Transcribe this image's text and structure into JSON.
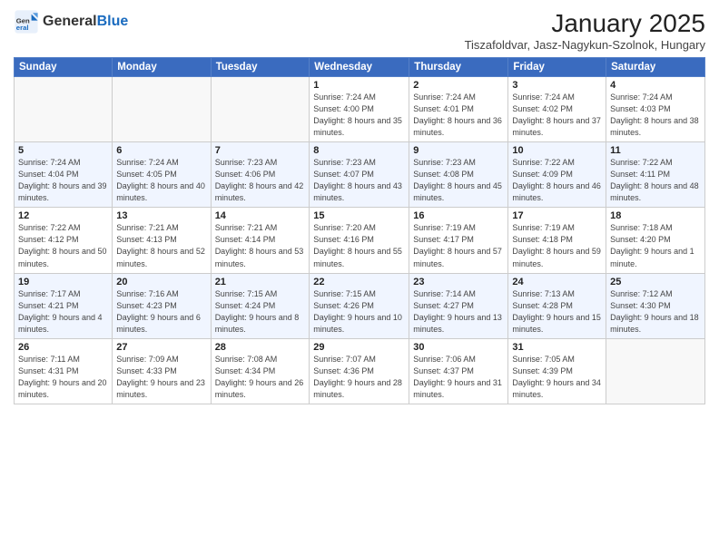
{
  "logo": {
    "general": "General",
    "blue": "Blue"
  },
  "title": "January 2025",
  "location": "Tiszafoldvar, Jasz-Nagykun-Szolnok, Hungary",
  "days_of_week": [
    "Sunday",
    "Monday",
    "Tuesday",
    "Wednesday",
    "Thursday",
    "Friday",
    "Saturday"
  ],
  "weeks": [
    [
      {
        "day": "",
        "info": ""
      },
      {
        "day": "",
        "info": ""
      },
      {
        "day": "",
        "info": ""
      },
      {
        "day": "1",
        "info": "Sunrise: 7:24 AM\nSunset: 4:00 PM\nDaylight: 8 hours and 35 minutes."
      },
      {
        "day": "2",
        "info": "Sunrise: 7:24 AM\nSunset: 4:01 PM\nDaylight: 8 hours and 36 minutes."
      },
      {
        "day": "3",
        "info": "Sunrise: 7:24 AM\nSunset: 4:02 PM\nDaylight: 8 hours and 37 minutes."
      },
      {
        "day": "4",
        "info": "Sunrise: 7:24 AM\nSunset: 4:03 PM\nDaylight: 8 hours and 38 minutes."
      }
    ],
    [
      {
        "day": "5",
        "info": "Sunrise: 7:24 AM\nSunset: 4:04 PM\nDaylight: 8 hours and 39 minutes."
      },
      {
        "day": "6",
        "info": "Sunrise: 7:24 AM\nSunset: 4:05 PM\nDaylight: 8 hours and 40 minutes."
      },
      {
        "day": "7",
        "info": "Sunrise: 7:23 AM\nSunset: 4:06 PM\nDaylight: 8 hours and 42 minutes."
      },
      {
        "day": "8",
        "info": "Sunrise: 7:23 AM\nSunset: 4:07 PM\nDaylight: 8 hours and 43 minutes."
      },
      {
        "day": "9",
        "info": "Sunrise: 7:23 AM\nSunset: 4:08 PM\nDaylight: 8 hours and 45 minutes."
      },
      {
        "day": "10",
        "info": "Sunrise: 7:22 AM\nSunset: 4:09 PM\nDaylight: 8 hours and 46 minutes."
      },
      {
        "day": "11",
        "info": "Sunrise: 7:22 AM\nSunset: 4:11 PM\nDaylight: 8 hours and 48 minutes."
      }
    ],
    [
      {
        "day": "12",
        "info": "Sunrise: 7:22 AM\nSunset: 4:12 PM\nDaylight: 8 hours and 50 minutes."
      },
      {
        "day": "13",
        "info": "Sunrise: 7:21 AM\nSunset: 4:13 PM\nDaylight: 8 hours and 52 minutes."
      },
      {
        "day": "14",
        "info": "Sunrise: 7:21 AM\nSunset: 4:14 PM\nDaylight: 8 hours and 53 minutes."
      },
      {
        "day": "15",
        "info": "Sunrise: 7:20 AM\nSunset: 4:16 PM\nDaylight: 8 hours and 55 minutes."
      },
      {
        "day": "16",
        "info": "Sunrise: 7:19 AM\nSunset: 4:17 PM\nDaylight: 8 hours and 57 minutes."
      },
      {
        "day": "17",
        "info": "Sunrise: 7:19 AM\nSunset: 4:18 PM\nDaylight: 8 hours and 59 minutes."
      },
      {
        "day": "18",
        "info": "Sunrise: 7:18 AM\nSunset: 4:20 PM\nDaylight: 9 hours and 1 minute."
      }
    ],
    [
      {
        "day": "19",
        "info": "Sunrise: 7:17 AM\nSunset: 4:21 PM\nDaylight: 9 hours and 4 minutes."
      },
      {
        "day": "20",
        "info": "Sunrise: 7:16 AM\nSunset: 4:23 PM\nDaylight: 9 hours and 6 minutes."
      },
      {
        "day": "21",
        "info": "Sunrise: 7:15 AM\nSunset: 4:24 PM\nDaylight: 9 hours and 8 minutes."
      },
      {
        "day": "22",
        "info": "Sunrise: 7:15 AM\nSunset: 4:26 PM\nDaylight: 9 hours and 10 minutes."
      },
      {
        "day": "23",
        "info": "Sunrise: 7:14 AM\nSunset: 4:27 PM\nDaylight: 9 hours and 13 minutes."
      },
      {
        "day": "24",
        "info": "Sunrise: 7:13 AM\nSunset: 4:28 PM\nDaylight: 9 hours and 15 minutes."
      },
      {
        "day": "25",
        "info": "Sunrise: 7:12 AM\nSunset: 4:30 PM\nDaylight: 9 hours and 18 minutes."
      }
    ],
    [
      {
        "day": "26",
        "info": "Sunrise: 7:11 AM\nSunset: 4:31 PM\nDaylight: 9 hours and 20 minutes."
      },
      {
        "day": "27",
        "info": "Sunrise: 7:09 AM\nSunset: 4:33 PM\nDaylight: 9 hours and 23 minutes."
      },
      {
        "day": "28",
        "info": "Sunrise: 7:08 AM\nSunset: 4:34 PM\nDaylight: 9 hours and 26 minutes."
      },
      {
        "day": "29",
        "info": "Sunrise: 7:07 AM\nSunset: 4:36 PM\nDaylight: 9 hours and 28 minutes."
      },
      {
        "day": "30",
        "info": "Sunrise: 7:06 AM\nSunset: 4:37 PM\nDaylight: 9 hours and 31 minutes."
      },
      {
        "day": "31",
        "info": "Sunrise: 7:05 AM\nSunset: 4:39 PM\nDaylight: 9 hours and 34 minutes."
      },
      {
        "day": "",
        "info": ""
      }
    ]
  ]
}
